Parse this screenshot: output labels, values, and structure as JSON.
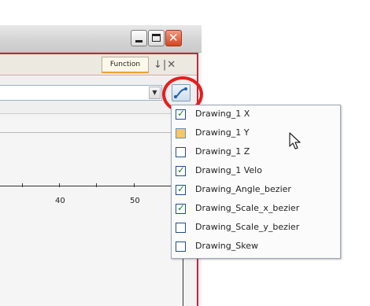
{
  "panel": {
    "tab_label": "Function",
    "tab_icons": "↓|✕",
    "combo_arrow": "▼"
  },
  "window_buttons": {
    "minimize": "–",
    "maximize": "□",
    "close": "✕"
  },
  "graph": {
    "tick_labels": [
      "40",
      "50"
    ]
  },
  "menu": {
    "items": [
      {
        "label": "Drawing_1 X",
        "state": "checked"
      },
      {
        "label": "Drawing_1 Y",
        "state": "partial"
      },
      {
        "label": "Drawing_1 Z",
        "state": "unchecked"
      },
      {
        "label": "Drawing_1 Velo",
        "state": "checked"
      },
      {
        "label": "Drawing_Angle_bezier",
        "state": "checked"
      },
      {
        "label": "Drawing_Scale_x_bezier",
        "state": "checked"
      },
      {
        "label": "Drawing_Scale_y_bezier",
        "state": "unchecked"
      },
      {
        "label": "Drawing_Skew",
        "state": "unchecked"
      }
    ]
  },
  "colors": {
    "highlight_ring": "#e61e1e",
    "panel_border": "#c8243a",
    "check_mark": "#1f8a1f"
  }
}
